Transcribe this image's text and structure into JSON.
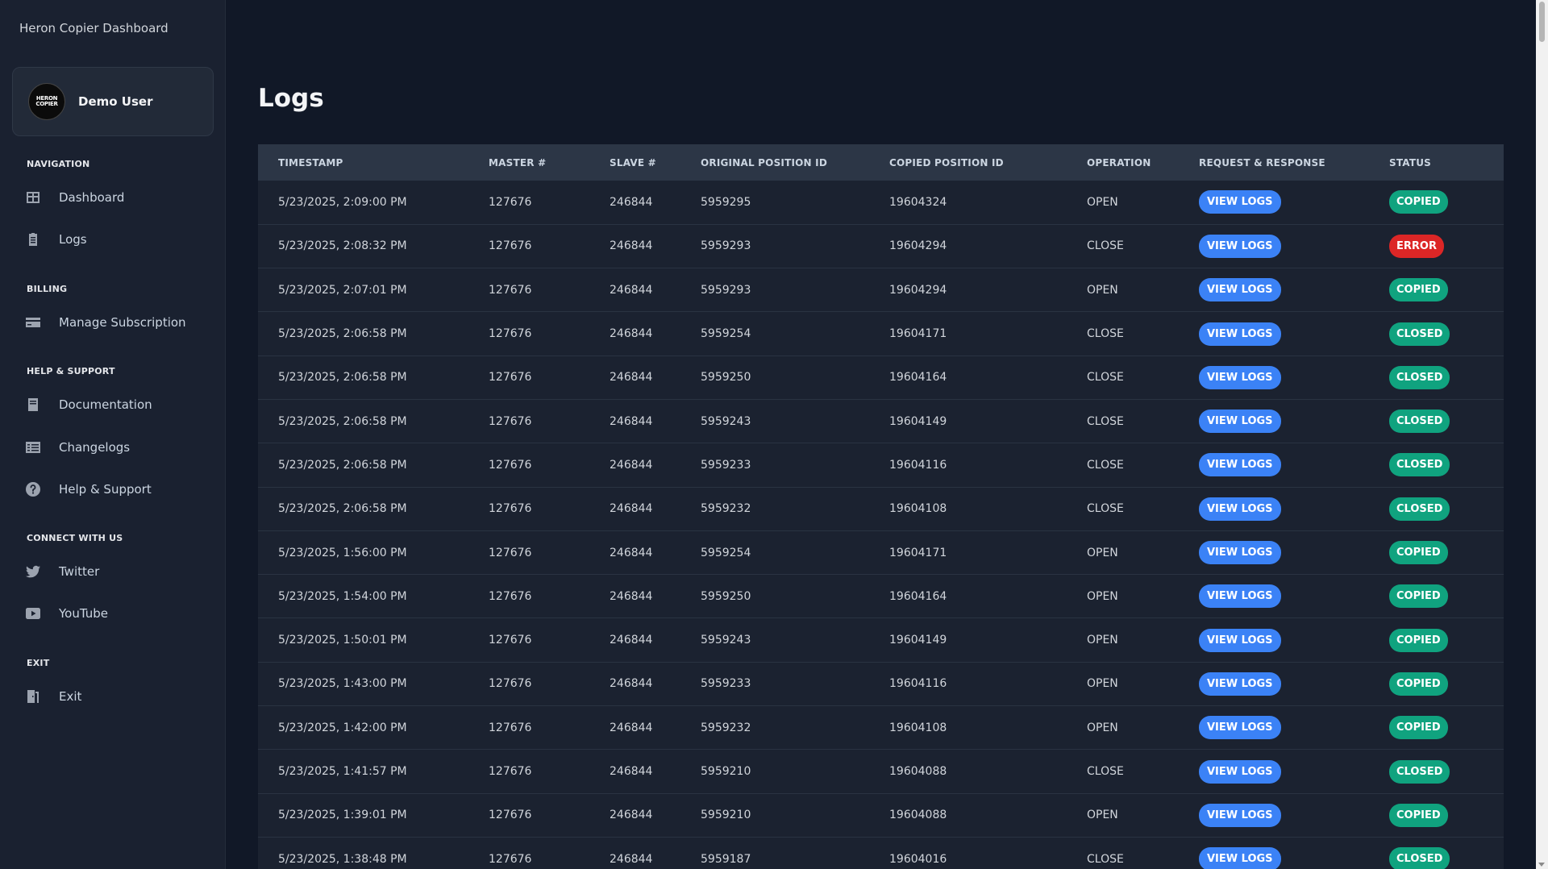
{
  "app": {
    "title": "Heron Copier Dashboard"
  },
  "user": {
    "name": "Demo User",
    "avatar_text_line1": "HERON",
    "avatar_text_line2": "COPIER"
  },
  "sidebar": {
    "sections": [
      {
        "label": "NAVIGATION",
        "items": [
          {
            "label": "Dashboard",
            "icon": "dashboard-icon"
          },
          {
            "label": "Logs",
            "icon": "clipboard-icon"
          }
        ]
      },
      {
        "label": "BILLING",
        "items": [
          {
            "label": "Manage Subscription",
            "icon": "credit-card-icon"
          }
        ]
      },
      {
        "label": "HELP & SUPPORT",
        "items": [
          {
            "label": "Documentation",
            "icon": "book-icon"
          },
          {
            "label": "Changelogs",
            "icon": "list-icon"
          },
          {
            "label": "Help & Support",
            "icon": "question-circle-icon"
          }
        ]
      },
      {
        "label": "CONNECT WITH US",
        "items": [
          {
            "label": "Twitter",
            "icon": "twitter-icon"
          },
          {
            "label": "YouTube",
            "icon": "youtube-icon"
          }
        ]
      },
      {
        "label": "EXIT",
        "items": [
          {
            "label": "Exit",
            "icon": "exit-door-icon"
          }
        ]
      }
    ]
  },
  "page": {
    "title": "Logs"
  },
  "colors": {
    "view_button": "#3b82f6",
    "status_copied": "#10a37f",
    "status_closed": "#10a37f",
    "status_error": "#dc2626"
  },
  "table": {
    "columns": [
      "TIMESTAMP",
      "MASTER #",
      "SLAVE #",
      "ORIGINAL POSITION ID",
      "COPIED POSITION ID",
      "OPERATION",
      "REQUEST & RESPONSE",
      "STATUS"
    ],
    "view_button_label": "VIEW LOGS",
    "rows": [
      {
        "timestamp": "5/23/2025, 2:09:00 PM",
        "master": "127676",
        "slave": "246844",
        "original_id": "5959295",
        "copied_id": "19604324",
        "operation": "OPEN",
        "status": "COPIED"
      },
      {
        "timestamp": "5/23/2025, 2:08:32 PM",
        "master": "127676",
        "slave": "246844",
        "original_id": "5959293",
        "copied_id": "19604294",
        "operation": "CLOSE",
        "status": "ERROR"
      },
      {
        "timestamp": "5/23/2025, 2:07:01 PM",
        "master": "127676",
        "slave": "246844",
        "original_id": "5959293",
        "copied_id": "19604294",
        "operation": "OPEN",
        "status": "COPIED"
      },
      {
        "timestamp": "5/23/2025, 2:06:58 PM",
        "master": "127676",
        "slave": "246844",
        "original_id": "5959254",
        "copied_id": "19604171",
        "operation": "CLOSE",
        "status": "CLOSED"
      },
      {
        "timestamp": "5/23/2025, 2:06:58 PM",
        "master": "127676",
        "slave": "246844",
        "original_id": "5959250",
        "copied_id": "19604164",
        "operation": "CLOSE",
        "status": "CLOSED"
      },
      {
        "timestamp": "5/23/2025, 2:06:58 PM",
        "master": "127676",
        "slave": "246844",
        "original_id": "5959243",
        "copied_id": "19604149",
        "operation": "CLOSE",
        "status": "CLOSED"
      },
      {
        "timestamp": "5/23/2025, 2:06:58 PM",
        "master": "127676",
        "slave": "246844",
        "original_id": "5959233",
        "copied_id": "19604116",
        "operation": "CLOSE",
        "status": "CLOSED"
      },
      {
        "timestamp": "5/23/2025, 2:06:58 PM",
        "master": "127676",
        "slave": "246844",
        "original_id": "5959232",
        "copied_id": "19604108",
        "operation": "CLOSE",
        "status": "CLOSED"
      },
      {
        "timestamp": "5/23/2025, 1:56:00 PM",
        "master": "127676",
        "slave": "246844",
        "original_id": "5959254",
        "copied_id": "19604171",
        "operation": "OPEN",
        "status": "COPIED"
      },
      {
        "timestamp": "5/23/2025, 1:54:00 PM",
        "master": "127676",
        "slave": "246844",
        "original_id": "5959250",
        "copied_id": "19604164",
        "operation": "OPEN",
        "status": "COPIED"
      },
      {
        "timestamp": "5/23/2025, 1:50:01 PM",
        "master": "127676",
        "slave": "246844",
        "original_id": "5959243",
        "copied_id": "19604149",
        "operation": "OPEN",
        "status": "COPIED"
      },
      {
        "timestamp": "5/23/2025, 1:43:00 PM",
        "master": "127676",
        "slave": "246844",
        "original_id": "5959233",
        "copied_id": "19604116",
        "operation": "OPEN",
        "status": "COPIED"
      },
      {
        "timestamp": "5/23/2025, 1:42:00 PM",
        "master": "127676",
        "slave": "246844",
        "original_id": "5959232",
        "copied_id": "19604108",
        "operation": "OPEN",
        "status": "COPIED"
      },
      {
        "timestamp": "5/23/2025, 1:41:57 PM",
        "master": "127676",
        "slave": "246844",
        "original_id": "5959210",
        "copied_id": "19604088",
        "operation": "CLOSE",
        "status": "CLOSED"
      },
      {
        "timestamp": "5/23/2025, 1:39:01 PM",
        "master": "127676",
        "slave": "246844",
        "original_id": "5959210",
        "copied_id": "19604088",
        "operation": "OPEN",
        "status": "COPIED"
      },
      {
        "timestamp": "5/23/2025, 1:38:48 PM",
        "master": "127676",
        "slave": "246844",
        "original_id": "5959187",
        "copied_id": "19604016",
        "operation": "CLOSE",
        "status": "CLOSED"
      }
    ]
  }
}
